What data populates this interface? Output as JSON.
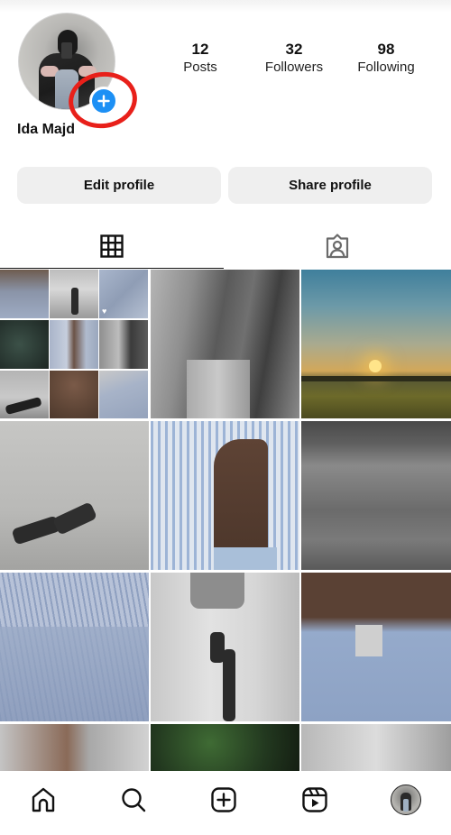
{
  "profile": {
    "username": "Ida Majd",
    "avatar_desc": "profile photo of a person sitting with phone",
    "add_story_icon": "plus-icon",
    "highlight_color": "#e8201a",
    "accent_color": "#1d90f5"
  },
  "stats": [
    {
      "value": "12",
      "label": "Posts"
    },
    {
      "value": "32",
      "label": "Followers"
    },
    {
      "value": "98",
      "label": "Following"
    }
  ],
  "buttons": {
    "edit_profile": "Edit profile",
    "share_profile": "Share profile"
  },
  "tabs": [
    {
      "name": "posts-grid",
      "icon": "grid-icon",
      "active": true
    },
    {
      "name": "tagged",
      "icon": "tagged-person-icon",
      "active": false
    }
  ],
  "grid_posts": [
    {
      "desc": "collage of 9 fashion photos",
      "type": "collage"
    },
    {
      "desc": "person in grey jacket and pleated skirt",
      "type": "photo"
    },
    {
      "desc": "sunset over wheat field",
      "type": "photo"
    },
    {
      "desc": "black knee-high boots on white fabric",
      "type": "photo"
    },
    {
      "desc": "blue striped shirt and jeans close-up",
      "type": "photo"
    },
    {
      "desc": "black and white ocean waves",
      "type": "photo"
    },
    {
      "desc": "blue striped shirt and denim",
      "type": "photo"
    },
    {
      "desc": "person in boots against white drape",
      "type": "photo"
    },
    {
      "desc": "necklace and blue denim knees",
      "type": "photo"
    },
    {
      "desc": "white textured top",
      "type": "photo"
    },
    {
      "desc": "green palm leaves",
      "type": "photo"
    },
    {
      "desc": "white knit top with tie",
      "type": "photo"
    }
  ],
  "bottom_nav": [
    {
      "name": "home",
      "icon": "home-icon"
    },
    {
      "name": "search",
      "icon": "search-icon"
    },
    {
      "name": "create",
      "icon": "add-post-icon"
    },
    {
      "name": "reels",
      "icon": "reels-icon"
    },
    {
      "name": "profile",
      "icon": "profile-avatar-icon"
    }
  ]
}
